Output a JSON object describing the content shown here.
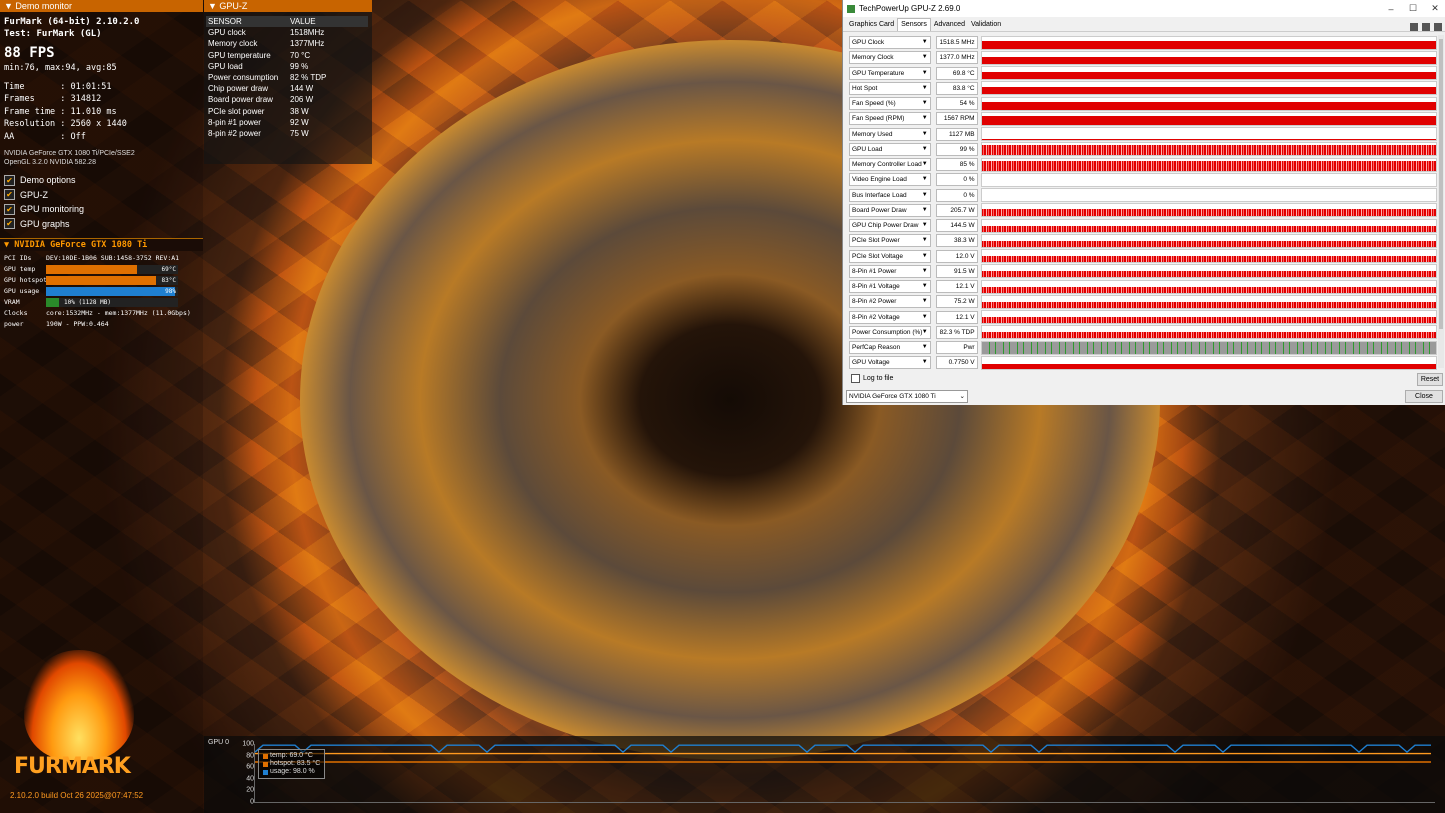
{
  "demo_monitor": {
    "header": "Demo monitor",
    "app_title": "FurMark (64-bit) 2.10.2.0",
    "test": "Test: FurMark (GL)",
    "fps": "88 FPS",
    "minmax": "min:76, max:94, avg:85",
    "stats": [
      "Time       : 01:01:51",
      "Frames     : 314812",
      "Frame time : 11.010 ms",
      "Resolution : 2560 x 1440",
      "AA         : Off"
    ],
    "gpu_line1": "NVIDIA GeForce GTX 1080 Ti/PCIe/SSE2",
    "gpu_line2": "OpenGL 3.2.0 NVIDIA 582.28",
    "options": [
      {
        "label": "Demo options",
        "checked": true
      },
      {
        "label": "GPU-Z",
        "checked": true
      },
      {
        "label": "GPU monitoring",
        "checked": true
      },
      {
        "label": "GPU graphs",
        "checked": true
      }
    ],
    "gpu_header": "NVIDIA GeForce GTX 1080 Ti",
    "pci_label": "PCI IDs",
    "pci_value": "DEV:10DE-1B06 SUB:1458-3752 REV:A1",
    "bars": [
      {
        "label": "GPU temp",
        "value": "69°C",
        "fraction": 0.69,
        "color": "#e07000"
      },
      {
        "label": "GPU hotspot",
        "value": "83°C",
        "fraction": 0.83,
        "color": "#e07000"
      },
      {
        "label": "GPU usage",
        "value": "98%",
        "fraction": 0.98,
        "color": "#1f7fd0"
      },
      {
        "label": "VRAM",
        "value": "10% (1128 MB)",
        "fraction": 0.1,
        "color": "#2a8a2a"
      }
    ],
    "clocks_label": "Clocks",
    "clocks_value": "core:1532MHz - mem:1377MHz (11.0Gbps)",
    "power_label": "power",
    "power_value": "190W - PPW:0.464",
    "logo_text": "FURMARK",
    "build": "2.10.2.0 build Oct 26 2025@07:47:52"
  },
  "gpuz_panel": {
    "header": "GPU-Z",
    "col_sensor": "SENSOR",
    "col_value": "VALUE",
    "rows": [
      {
        "sensor": "GPU clock",
        "value": "1518MHz"
      },
      {
        "sensor": "Memory clock",
        "value": "1377MHz"
      },
      {
        "sensor": "GPU temperature",
        "value": "70 °C"
      },
      {
        "sensor": "GPU load",
        "value": "99 %"
      },
      {
        "sensor": "Power consumption",
        "value": "82 % TDP"
      },
      {
        "sensor": "Chip power draw",
        "value": "144 W"
      },
      {
        "sensor": "Board power draw",
        "value": "206 W"
      },
      {
        "sensor": "PCIe slot power",
        "value": "38 W"
      },
      {
        "sensor": "8-pin #1 power",
        "value": "92 W"
      },
      {
        "sensor": "8-pin #2 power",
        "value": "75 W"
      }
    ]
  },
  "gpuz_window": {
    "title": "TechPowerUp GPU-Z 2.69.0",
    "tabs": [
      "Graphics Card",
      "Sensors",
      "Advanced",
      "Validation"
    ],
    "active_tab": 1,
    "sensors": [
      {
        "name": "GPU Clock",
        "value": "1518.5 MHz",
        "level": 0.6,
        "style": "solid"
      },
      {
        "name": "Memory Clock",
        "value": "1377.0 MHz",
        "level": 0.6,
        "style": "solid"
      },
      {
        "name": "GPU Temperature",
        "value": "69.8 °C",
        "level": 0.6,
        "style": "solid"
      },
      {
        "name": "Hot Spot",
        "value": "83.8 °C",
        "level": 0.6,
        "style": "solid"
      },
      {
        "name": "Fan Speed (%)",
        "value": "54 %",
        "level": 0.6,
        "style": "solid"
      },
      {
        "name": "Fan Speed (RPM)",
        "value": "1567 RPM",
        "level": 0.7,
        "style": "solid"
      },
      {
        "name": "Memory Used",
        "value": "1127 MB",
        "level": 0.1,
        "style": "solid"
      },
      {
        "name": "GPU Load",
        "value": "99 %",
        "level": 0.9,
        "style": "noisy"
      },
      {
        "name": "Memory Controller Load",
        "value": "85 %",
        "level": 0.8,
        "style": "noisy"
      },
      {
        "name": "Video Engine Load",
        "value": "0 %",
        "level": 0.0,
        "style": "solid"
      },
      {
        "name": "Bus Interface Load",
        "value": "0 %",
        "level": 0.0,
        "style": "solid"
      },
      {
        "name": "Board Power Draw",
        "value": "205.7 W",
        "level": 0.6,
        "style": "noisy"
      },
      {
        "name": "GPU Chip Power Draw",
        "value": "144.5 W",
        "level": 0.5,
        "style": "noisy"
      },
      {
        "name": "PCIe Slot Power",
        "value": "38.3 W",
        "level": 0.5,
        "style": "noisy"
      },
      {
        "name": "PCIe Slot Voltage",
        "value": "12.0 V",
        "level": 0.5,
        "style": "noisy"
      },
      {
        "name": "8-Pin #1 Power",
        "value": "91.5 W",
        "level": 0.5,
        "style": "noisy"
      },
      {
        "name": "8-Pin #1 Voltage",
        "value": "12.1 V",
        "level": 0.5,
        "style": "noisy"
      },
      {
        "name": "8-Pin #2 Power",
        "value": "75.2 W",
        "level": 0.5,
        "style": "noisy"
      },
      {
        "name": "8-Pin #2 Voltage",
        "value": "12.1 V",
        "level": 0.5,
        "style": "noisy"
      },
      {
        "name": "Power Consumption (%)",
        "value": "82.3 % TDP",
        "level": 0.5,
        "style": "noisy"
      },
      {
        "name": "PerfCap Reason",
        "value": "Pwr",
        "level": 1.0,
        "style": "perf"
      },
      {
        "name": "GPU Voltage",
        "value": "0.7750 V",
        "level": 0.4,
        "style": "solid"
      }
    ],
    "log_label": "Log to file",
    "reset_label": "Reset",
    "gpu_select": "NVIDIA GeForce GTX 1080 Ti",
    "close_label": "Close"
  },
  "bottom_graph": {
    "label": "GPU 0",
    "ticks": [
      "100",
      "80",
      "60",
      "40",
      "20",
      "0"
    ],
    "legend": [
      {
        "text": "temp: 69.0 °C",
        "color": "#e07000"
      },
      {
        "text": "hotspot: 83.5 °C",
        "color": "#e07000"
      },
      {
        "text": "usage: 98.0 %",
        "color": "#1f7fd0"
      }
    ],
    "series_levels": {
      "temp": 69,
      "hotspot": 83.5,
      "usage": 98
    }
  }
}
